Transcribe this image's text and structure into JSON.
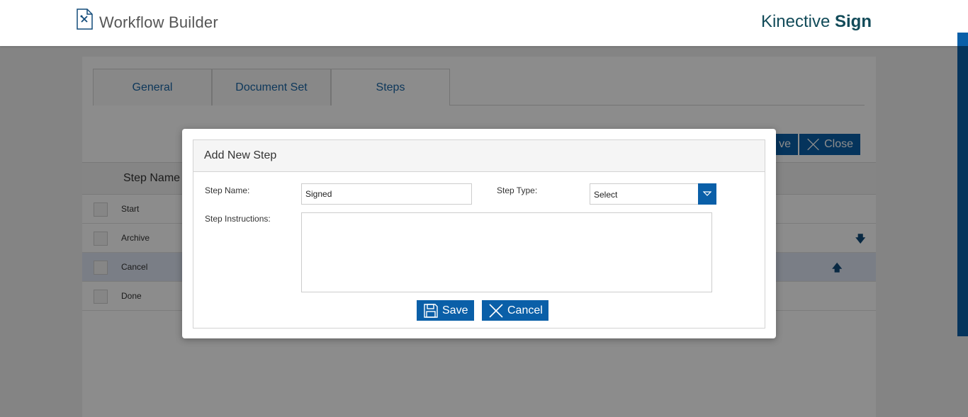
{
  "header": {
    "app_title": "Workflow Builder",
    "brand_regular": "Kinective ",
    "brand_bold": "Sign"
  },
  "tabs": [
    {
      "label": "General"
    },
    {
      "label": "Document Set"
    },
    {
      "label": "Steps"
    }
  ],
  "toolbar": {
    "save_label": "ve",
    "close_label": "Close"
  },
  "grid": {
    "column_header": "Step Name",
    "rows": [
      {
        "label": "Start"
      },
      {
        "label": "Archive",
        "arrow": "down"
      },
      {
        "label": "Cancel",
        "arrow": "up",
        "selected": true
      },
      {
        "label": "Done"
      }
    ]
  },
  "modal": {
    "title": "Add New Step",
    "step_name_label": "Step Name:",
    "step_name_value": "Signed",
    "step_type_label": "Step Type:",
    "step_type_value": "Select",
    "instructions_label": "Step Instructions:",
    "instructions_value": "",
    "save_label": "Save",
    "cancel_label": "Cancel"
  },
  "colors": {
    "accent": "#0a5fa8",
    "brand_text": "#124b59",
    "selected_row": "#dfe6f5"
  }
}
